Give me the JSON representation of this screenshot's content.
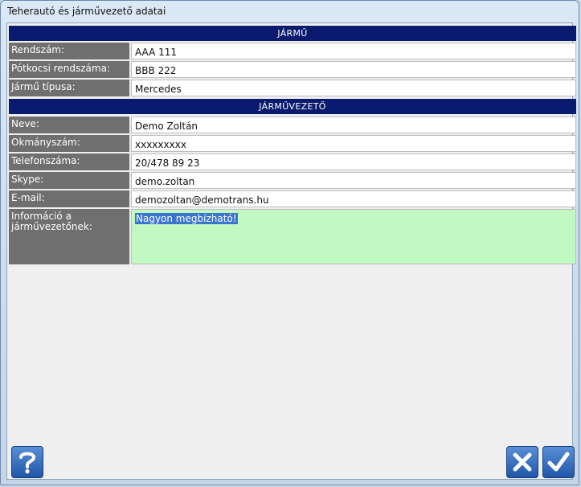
{
  "window": {
    "title": "Teherautó és járművezető adatai"
  },
  "sections": {
    "vehicle": {
      "header": "JÁRMŰ",
      "rows": [
        {
          "label": "Rendszám:",
          "value": "AAA 111"
        },
        {
          "label": "Pótkocsi rendszáma:",
          "value": "BBB 222"
        },
        {
          "label": "Jármű típusa:",
          "value": "Mercedes"
        }
      ]
    },
    "driver": {
      "header": "JÁRMŰVEZETŐ",
      "rows": [
        {
          "label": "Neve:",
          "value": "Demo Zoltán"
        },
        {
          "label": "Okmányszám:",
          "value": "xxxxxxxxx"
        },
        {
          "label": "Telefonszáma:",
          "value": "20/478 89 23"
        },
        {
          "label": "Skype:",
          "value": "demo.zoltan"
        },
        {
          "label": "E-mail:",
          "value": "demozoltan@demotrans.hu"
        }
      ],
      "info": {
        "label": "Információ a járművezetőnek:",
        "value": "Nagyon megbízható!"
      }
    }
  },
  "buttons": {
    "help": {
      "icon": "question-icon",
      "color": "#2a62b8"
    },
    "cancel": {
      "icon": "x-icon"
    },
    "ok": {
      "icon": "checkmark-icon"
    }
  },
  "colors": {
    "header_bg": "#0a1a6e",
    "label_bg": "#6f6f6f",
    "info_bg": "#c2f9c2",
    "selection": "#3a75d0"
  }
}
